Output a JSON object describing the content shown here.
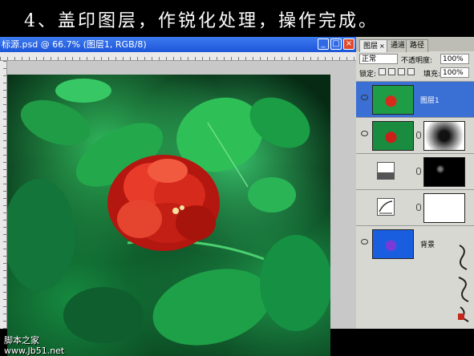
{
  "caption": "4、盖印图层，作锐化处理，操作完成。",
  "window": {
    "title": "标源.psd @ 66.7% (图层1, RGB/8)",
    "buttons": {
      "minimize": "_",
      "maximize": "□",
      "close": "×"
    }
  },
  "watermark": {
    "site_name": "脚本之家",
    "url": "www.Jb51.net"
  },
  "panel": {
    "tabs": [
      "图层",
      "通道",
      "路径"
    ],
    "tab_close": "×",
    "blend_mode": "正常",
    "opacity_label": "不透明度:",
    "opacity_value": "100%",
    "lock_label": "锁定:",
    "fill_label": "填充:",
    "fill_value": "100%",
    "layers": [
      {
        "name": "图层1",
        "selected": true,
        "visible": true
      },
      {
        "name": "",
        "selected": false,
        "visible": true
      },
      {
        "name": "",
        "selected": false,
        "visible": false
      },
      {
        "name": "",
        "selected": false,
        "visible": false
      },
      {
        "name": "背景",
        "selected": false,
        "visible": true
      }
    ]
  },
  "icons": [
    "eye-icon",
    "chain-link-icon",
    "lock-transparent-icon",
    "lock-paint-icon",
    "lock-move-icon",
    "lock-all-icon",
    "levels-adjustment-icon",
    "curves-adjustment-icon"
  ],
  "colors": {
    "titlebar": "#2a64e0",
    "selected_layer": "#3a6fd4",
    "flower_red": "#d8261c"
  }
}
